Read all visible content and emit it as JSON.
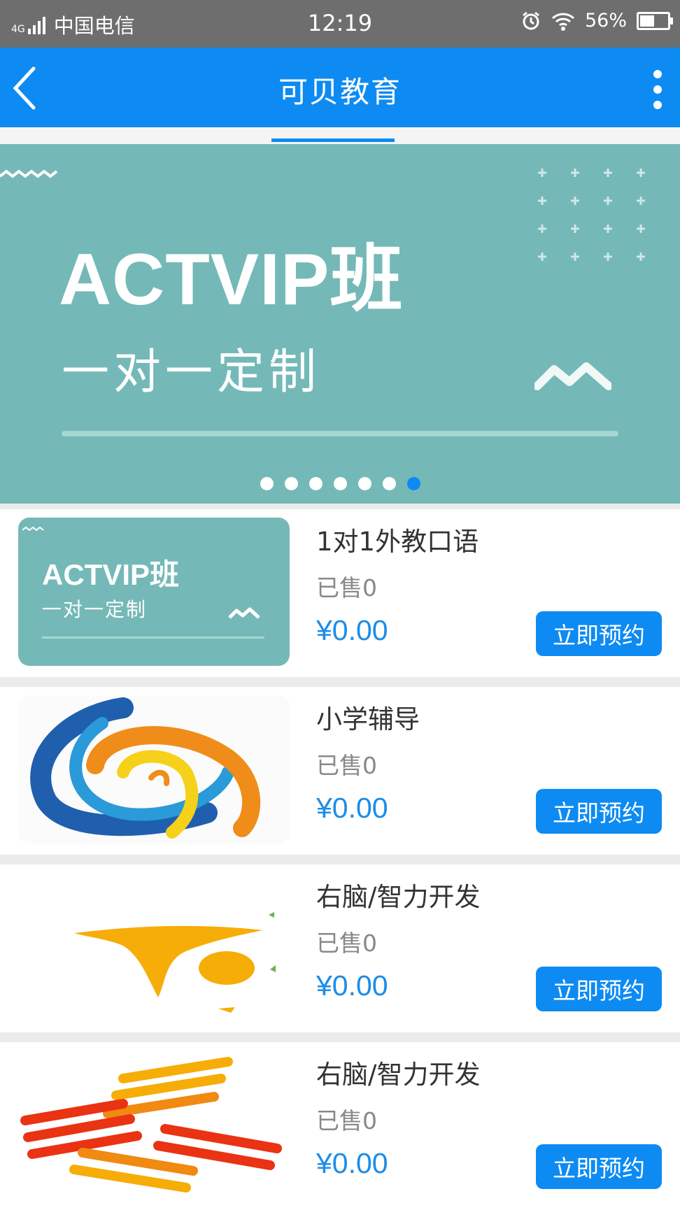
{
  "status_bar": {
    "network": "4G",
    "carrier": "中国电信",
    "time": "12:19",
    "battery": "56%",
    "battery_level": 0.56
  },
  "header": {
    "title": "可贝教育"
  },
  "banner": {
    "headline": "ACTVIP班",
    "subtitle": "一对一定制",
    "slide_count": 7,
    "active_slide": 7
  },
  "courses": [
    {
      "name": "1对1外教口语",
      "sold": "已售0",
      "price": "¥0.00",
      "button": "立即预约",
      "thumb_headline": "ACTVIP班",
      "thumb_subtitle": "一对一定制"
    },
    {
      "name": "小学辅导",
      "sold": "已售0",
      "price": "¥0.00",
      "button": "立即预约"
    },
    {
      "name": "右脑/智力开发",
      "sold": "已售0",
      "price": "¥0.00",
      "button": "立即预约"
    },
    {
      "name": "右脑/智力开发",
      "sold": "已售0",
      "price": "¥0.00",
      "button": "立即预约"
    }
  ],
  "colors": {
    "primary": "#0d8bf2",
    "banner_teal": "#74b9b7",
    "price": "#1c8de8"
  }
}
